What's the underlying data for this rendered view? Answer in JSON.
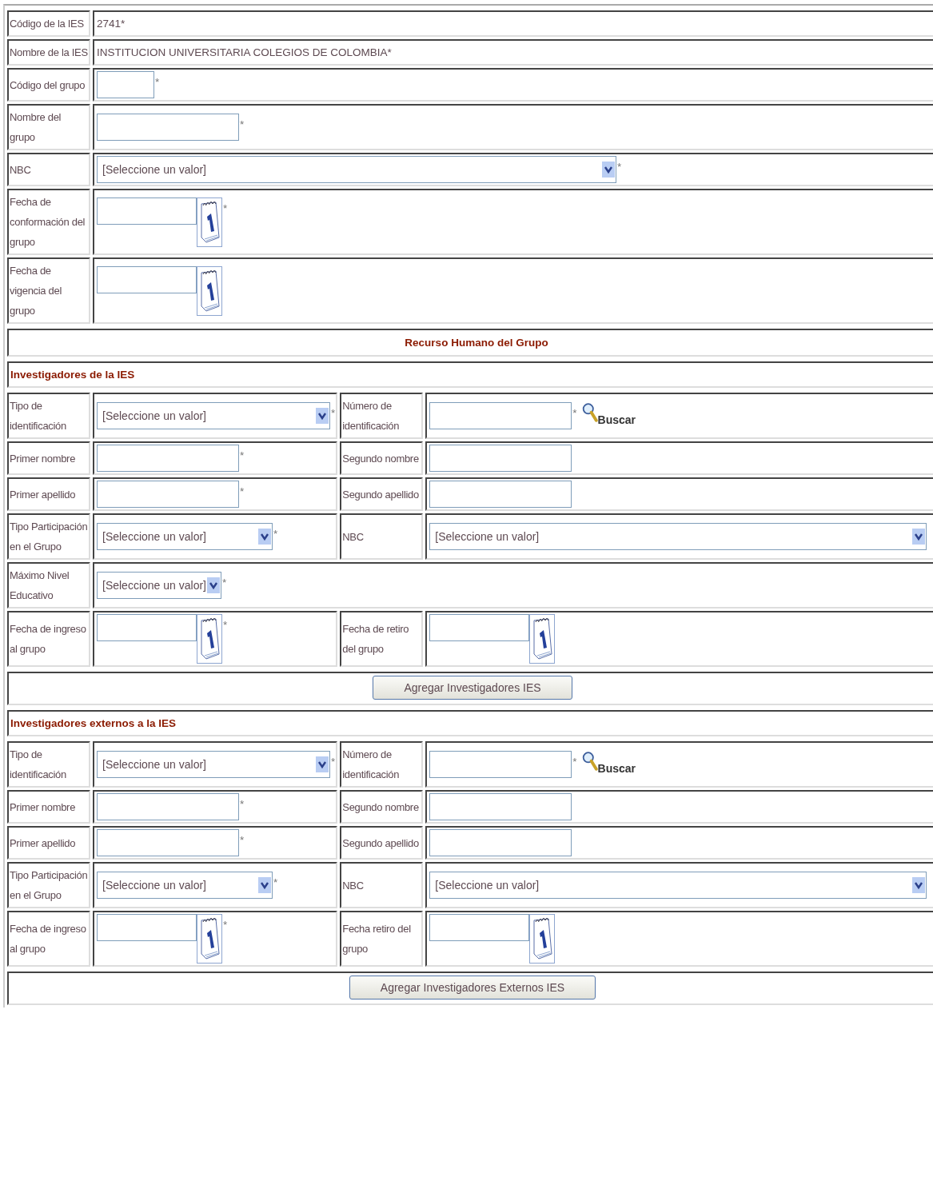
{
  "ies_form": {
    "rows": [
      {
        "label": "Código de la IES",
        "field": {
          "kind": "text",
          "value": "2741*"
        }
      },
      {
        "label": "Nombre de la IES",
        "field": {
          "kind": "text",
          "value": "INSTITUCION UNIVERSITARIA COLEGIOS DE COLOMBIA*"
        }
      },
      {
        "label": "Código del grupo",
        "field": {
          "kind": "short-input",
          "mark": "*"
        }
      },
      {
        "label": "Nombre del grupo",
        "field": {
          "kind": "input",
          "mark": "*"
        }
      },
      {
        "label": "NBC",
        "field": {
          "kind": "wide-select",
          "value": "[Seleccione un valor]",
          "mark": "*"
        }
      },
      {
        "label": "Fecha de conformación del grupo",
        "field": {
          "kind": "date",
          "mark": "*"
        }
      },
      {
        "label": "Fecha de vigencia del grupo",
        "field": {
          "kind": "date"
        }
      }
    ]
  },
  "section_title": "Recurso Humano del Grupo",
  "groups": [
    {
      "title": "Investigadores de la IES",
      "rows": [
        {
          "cells": [
            {
              "label": "Tipo de identificación",
              "field": {
                "kind": "select",
                "value": "[Seleccione un valor]",
                "mark": "*"
              }
            },
            {
              "label": "Número de identificación",
              "field": {
                "kind": "input",
                "mark": "*",
                "search_link": "Buscar"
              }
            }
          ]
        },
        {
          "cells": [
            {
              "label": "Primer nombre",
              "field": {
                "kind": "input",
                "mark": "*"
              }
            },
            {
              "label": "Segundo nombre",
              "field": {
                "kind": "input"
              }
            }
          ]
        },
        {
          "cells": [
            {
              "label": "Primer apellido",
              "field": {
                "kind": "input",
                "mark": "*"
              }
            },
            {
              "label": "Segundo apellido",
              "field": {
                "kind": "input"
              }
            }
          ]
        },
        {
          "cells": [
            {
              "label": "Tipo Participación en el Grupo",
              "field": {
                "kind": "narrow-select",
                "value": "[Seleccione un valor]",
                "mark": "*"
              }
            },
            {
              "label": "NBC",
              "field": {
                "kind": "full-select",
                "value": "[Seleccione un valor]"
              }
            }
          ]
        },
        {
          "cells": [
            {
              "label": "Máximo Nivel Educativo",
              "field": {
                "kind": "small-select",
                "value": "[Seleccione un valor]",
                "mark": "*"
              }
            }
          ]
        },
        {
          "cells": [
            {
              "label": "Fecha de ingreso al grupo",
              "field": {
                "kind": "date",
                "mark": "*"
              }
            },
            {
              "label": "Fecha de retiro del grupo",
              "field": {
                "kind": "date"
              }
            }
          ]
        }
      ],
      "button": "Agregar Investigadores IES"
    },
    {
      "title": "Investigadores externos a la IES",
      "rows": [
        {
          "cells": [
            {
              "label": "Tipo de identificación",
              "field": {
                "kind": "select",
                "value": "[Seleccione un valor]",
                "mark": "*"
              }
            },
            {
              "label": "Número de identificación",
              "field": {
                "kind": "input",
                "mark": "*",
                "search_link": "Buscar"
              }
            }
          ]
        },
        {
          "cells": [
            {
              "label": "Primer nombre",
              "field": {
                "kind": "input",
                "mark": "*"
              }
            },
            {
              "label": "Segundo nombre",
              "field": {
                "kind": "input"
              }
            }
          ]
        },
        {
          "cells": [
            {
              "label": "Primer apellido",
              "field": {
                "kind": "input",
                "mark": "*"
              }
            },
            {
              "label": "Segundo apellido",
              "field": {
                "kind": "input"
              }
            }
          ]
        },
        {
          "cells": [
            {
              "label": "Tipo Participación en el Grupo",
              "field": {
                "kind": "narrow-select",
                "value": "[Seleccione un valor]",
                "mark": "*"
              }
            },
            {
              "label": "NBC",
              "field": {
                "kind": "full-select",
                "value": "[Seleccione un valor]"
              }
            }
          ]
        },
        {
          "cells": [
            {
              "label": "Fecha de ingreso al grupo",
              "field": {
                "kind": "date",
                "mark": "*"
              }
            },
            {
              "label": "Fecha retiro del grupo",
              "field": {
                "kind": "date"
              }
            }
          ]
        }
      ],
      "button": "Agregar Investigadores Externos IES"
    }
  ]
}
